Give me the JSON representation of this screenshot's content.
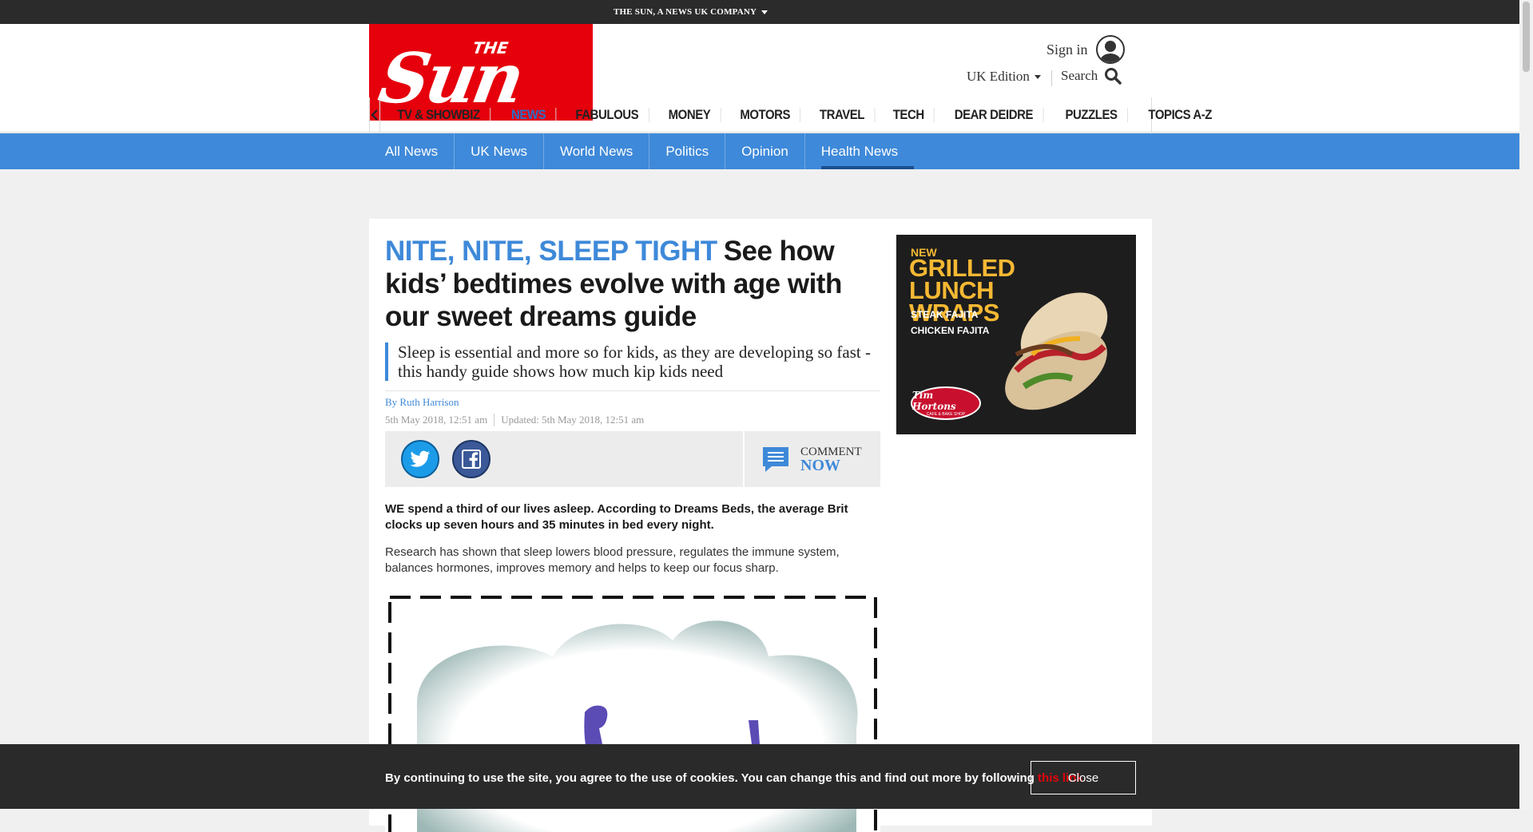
{
  "topbar": {
    "company": "THE SUN, A NEWS UK COMPANY"
  },
  "logo": {
    "the": "THE",
    "sun": "Sun"
  },
  "header": {
    "signin": "Sign in",
    "edition": "UK Edition",
    "search": "Search"
  },
  "nav": {
    "items": [
      "TV & SHOWBIZ",
      "NEWS",
      "FABULOUS",
      "MONEY",
      "MOTORS",
      "TRAVEL",
      "TECH",
      "DEAR DEIDRE",
      "PUZZLES",
      "TOPICS A-Z"
    ],
    "active": "NEWS"
  },
  "subnav": {
    "items": [
      "All News",
      "UK News",
      "World News",
      "Politics",
      "Opinion",
      "Health News"
    ],
    "active": "Health News"
  },
  "article": {
    "kicker": "NITE, NITE, SLEEP TIGHT",
    "headline": "See how kids’ bedtimes evolve with age with our sweet dreams guide",
    "standfirst": "Sleep is essential and more so for kids, as they are developing so fast - this handy guide shows how much kip kids need",
    "byline_prefix": "By ",
    "author": "Ruth Harrison",
    "published": "5th May 2018, 12:51 am",
    "updated": "Updated: 5th May 2018, 12:51 am",
    "comment_l1": "COMMENT",
    "comment_l2": "NOW",
    "lead": "WE spend a third of our lives asleep. According to Dreams Beds, the average Brit clocks up seven hours and 35 minutes in bed every night.",
    "body": "Research has shown that sleep lowers blood pressure, regulates the immune system, balances hormones, improves memory and helps to keep our focus sharp."
  },
  "ad": {
    "new": "NEW",
    "title": "GRILLED LUNCH WRAPS",
    "items": [
      "STEAK FAJITA",
      "CHICKEN FAJITA"
    ],
    "brand": "Tim Hortons",
    "brand_sub": "CAFE & BAKE SHOP"
  },
  "cookie": {
    "message": "By continuing to use the site, you agree to the use of cookies. You can change this and find out more by following ",
    "link": "this link",
    "close": "Close"
  },
  "colors": {
    "brand_red": "#e5000c",
    "accent_blue": "#3e89d9"
  }
}
